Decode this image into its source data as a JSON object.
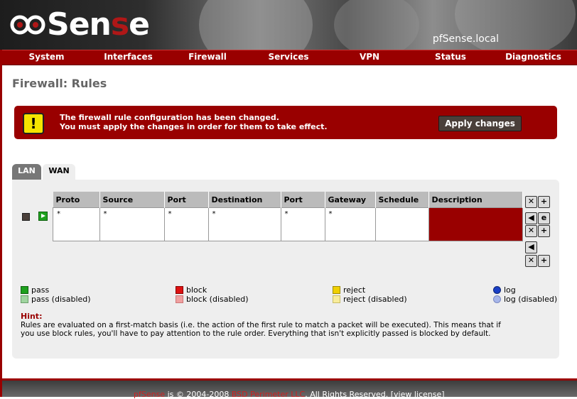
{
  "app": {
    "hostname": "pfSense.local",
    "logo": "pfSense"
  },
  "nav": [
    "System",
    "Interfaces",
    "Firewall",
    "Services",
    "VPN",
    "Status",
    "Diagnostics"
  ],
  "page_title": "Firewall: Rules",
  "alert": {
    "line1": "The firewall rule configuration has been changed.",
    "line2": "You must apply the changes in order for them to take effect.",
    "button": "Apply changes",
    "icon": "warning-exclamation-icon"
  },
  "tabs": [
    {
      "label": "LAN",
      "active": false
    },
    {
      "label": "WAN",
      "active": true
    }
  ],
  "table": {
    "columns": [
      "Proto",
      "Source",
      "Port",
      "Destination",
      "Port",
      "Gateway",
      "Schedule",
      "Description"
    ],
    "rows": [
      {
        "proto": "*",
        "source": "*",
        "port": "*",
        "destination": "*",
        "dport": "*",
        "gateway": "*",
        "schedule": "",
        "description": ""
      }
    ]
  },
  "legend": {
    "pass": "pass",
    "pass_disabled": "pass (disabled)",
    "block": "block",
    "block_disabled": "block (disabled)",
    "reject": "reject",
    "reject_disabled": "reject (disabled)",
    "log": "log",
    "log_disabled": "log (disabled)"
  },
  "hint": {
    "title": "Hint:",
    "text": "Rules are evaluated on a first-match basis (i.e. the action of the first rule to match a packet will be executed). This means that if you use block rules, you'll have to pay attention to the rule order. Everything that isn't explicitly passed is blocked by default."
  },
  "footer": {
    "brand": "pfSense",
    "middle": " is © 2004-2008 ",
    "company": "BSD Perimeter LLC",
    "rights": ". All Rights Reserved. [view license]"
  },
  "colors": {
    "accent": "#990000",
    "panel": "#eeeeee"
  }
}
